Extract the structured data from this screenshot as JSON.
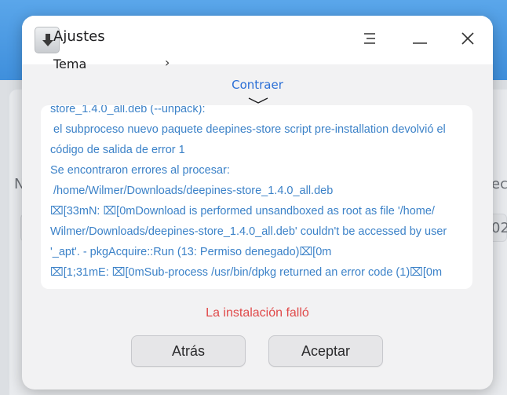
{
  "background": {
    "left_text": "N",
    "right_text": "ech",
    "row_right_text": "02"
  },
  "dialog": {
    "settings_title": "Ajustes",
    "settings_item": "Tema",
    "settings_chevron": "›",
    "collapse_label": "Contraer",
    "log_lines": [
      "store_1.4.0_all.deb (--unpack):",
      " el subproceso nuevo paquete deepines-store script pre-installation devolvió el",
      "código de salida de error 1",
      "Se encontraron errores al procesar:",
      " /home/Wilmer/Downloads/deepines-store_1.4.0_all.deb",
      "⌧[33mN: ⌧[0mDownload is performed unsandboxed as root as file '/home/",
      "Wilmer/Downloads/deepines-store_1.4.0_all.deb' couldn't be accessed by user",
      "'_apt'. - pkgAcquire::Run (13: Permiso denegado)⌧[0m",
      "⌧[1;31mE: ⌧[0mSub-process /usr/bin/dpkg returned an error code (1)⌧[0m"
    ],
    "status": "La instalación falló",
    "back_label": "Atrás",
    "accept_label": "Aceptar"
  },
  "colors": {
    "accent": "#2b6fd6",
    "log_text": "#3c82c8",
    "error": "#e04a4a",
    "header_blue": "#3f8fdc"
  },
  "icons": {
    "app": "download-package-icon",
    "menu": "menu-icon",
    "minimize": "minimize-icon",
    "close": "close-icon",
    "collapse": "chevron-down-icon"
  }
}
